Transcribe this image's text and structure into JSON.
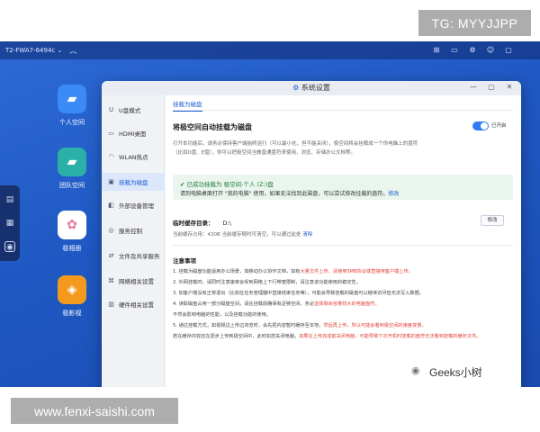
{
  "overlay": {
    "tg_text": "TG: MYYJJPP",
    "url_text": "www.fenxi-saishi.com",
    "weibo_text": "Geeks小树"
  },
  "topbar": {
    "device": "T2-FWA7-6494c ⌄"
  },
  "dock_icons": [
    "apps-icon",
    "grid-icon",
    "disk-icon"
  ],
  "desktop_apps": [
    {
      "label": "个人空间",
      "icon": "folder-icon",
      "color": "#3b8af5"
    },
    {
      "label": "团队空间",
      "icon": "team-folder-icon",
      "color": "#2bb0a8"
    },
    {
      "label": "极相册",
      "icon": "photos-icon",
      "color": "#ffffff"
    },
    {
      "label": "极影视",
      "icon": "video-icon",
      "color": "#f39a1e"
    }
  ],
  "window": {
    "title": "系统设置"
  },
  "nav": [
    {
      "label": "U盘模式"
    },
    {
      "label": "HDMI桌面"
    },
    {
      "label": "WLAN热点"
    },
    {
      "label": "挂载为磁盘"
    },
    {
      "label": "外部设备管理"
    },
    {
      "label": "服务控制"
    },
    {
      "label": "文件及共享服务"
    },
    {
      "label": "网络相关设置"
    },
    {
      "label": "硬件相关设置"
    }
  ],
  "content": {
    "tab": "挂载为磁盘",
    "heading": "将极空间自动挂载为磁盘",
    "toggle_state": "已开启",
    "desc1": "打开本功能后，请务必保持客户端始终运行（可以最小化，但不能关闭），极空间将会挂载成一个你电脑上的盘符",
    "desc2": "（比如D盘、E盘），你可以把极空间当做普通盘符来使用，浏览、存储办公文档等。",
    "ok_title": "已成功挂载为 极空间-个人 (Z:)盘",
    "ok_desc": "请到电脑桌面打开 \"我的电脑\" 使用，如果无法找到此磁盘，可以尝试修改挂载的盘符。",
    "ok_link": "修改",
    "cache_label": "临时缓存目录：",
    "cache_value": "D:\\",
    "change_button": "修改",
    "cache_usage": "当前缓存占用：430B   当前缓存随时可清空，可以通过此处 ",
    "cache_clear": "清除",
    "notes_title": "注意事项",
    "notes": [
      {
        "text": "1. 挂载为磁盘功能适用办公场景，如移动办公协作文档，如有",
        "hl": "大量文件上传，请使用SMB协议或直接用客户端上传。"
      },
      {
        "text": "2. 外网挂载时，请同时注意速率会受到网络上下行带宽限制，请注意该功能使用的稳定性，",
        "hl": ""
      },
      {
        "text": "3. 如客户端没有正常退出（比如在任务管理器中直接结束任务等），可能会导致挂载的磁盘可以继续访问但无法写入数据。",
        "hl": ""
      },
      {
        "text": "4. 读取磁盘占用一部分磁盘空间，请在挂载前确保有足够空间，务必",
        "hl": "选择剩余容量较大的电脑盘符，"
      },
      {
        "text": "   不然会影响电脑的性能，以及挂载功能的使用。",
        "hl": ""
      },
      {
        "text": "5. 通过挂载方式，如视频边上传边浏览时，会先把内容暂时缓存至本地，",
        "hl": "然后再上传，所以可能会看到极空间的速度变慢，"
      },
      {
        "text": "   若在缓存内容还在逐步上传到极空间中，此时如您关闭电脑，",
        "hl": "如果在上传完成前关闭电脑，可能导致下次开机时挂载的盘符无法看到挂载的缓存文件。"
      }
    ]
  }
}
